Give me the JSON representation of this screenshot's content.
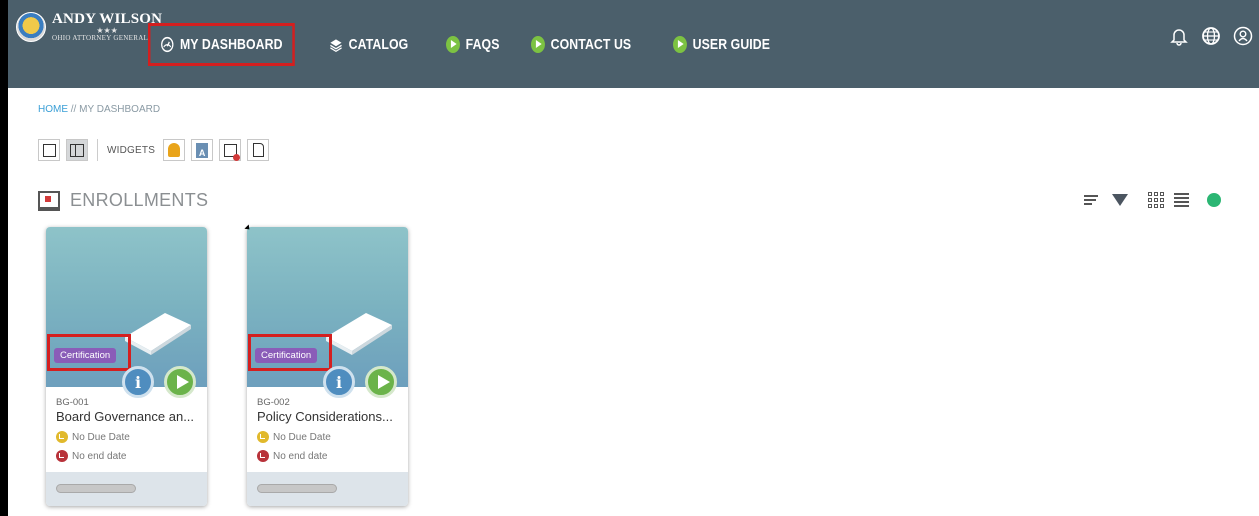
{
  "header": {
    "logo": {
      "name": "ANDY WILSON",
      "stars": "★★★",
      "subtitle": "OHIO ATTORNEY GENERAL"
    },
    "nav": [
      {
        "label": "MY DASHBOARD",
        "icon": "dashboard-gauge-icon",
        "active": true
      },
      {
        "label": "CATALOG",
        "icon": "catalog-layers-icon"
      },
      {
        "label": "FAQS",
        "icon": "play-circle-icon"
      },
      {
        "label": "CONTACT US",
        "icon": "play-circle-icon"
      },
      {
        "label": "USER GUIDE",
        "icon": "play-circle-icon"
      }
    ],
    "right_icons": [
      "bell-icon",
      "globe-icon",
      "user-profile-icon"
    ]
  },
  "breadcrumb": {
    "home": "HOME",
    "separator": " // ",
    "current": "MY DASHBOARD"
  },
  "widgets": {
    "label": "WIDGETS",
    "layout_icons": [
      "single-column-icon",
      "two-column-icon"
    ],
    "widget_icons": [
      "notification-bell-widget-icon",
      "book-widget-icon",
      "chat-widget-icon",
      "document-widget-icon"
    ]
  },
  "enrollments": {
    "title": "ENROLLMENTS",
    "tools": [
      "sort-icon",
      "filter-icon",
      "grid-view-icon",
      "list-view-icon",
      "refresh-icon"
    ],
    "cards": [
      {
        "badge": "Certification",
        "code": "BG-001",
        "title": "Board Governance an...",
        "due": "No Due Date",
        "end": "No end date",
        "progress": 0
      },
      {
        "badge": "Certification",
        "code": "BG-002",
        "title": "Policy Considerations...",
        "due": "No Due Date",
        "end": "No end date",
        "progress": 0
      }
    ]
  },
  "colors": {
    "topbar": "#4b5f6b",
    "highlight_box": "#d41f1f",
    "badge": "#8a5cb8",
    "play_green": "#7cc242",
    "info_blue": "#4f8dbf"
  }
}
